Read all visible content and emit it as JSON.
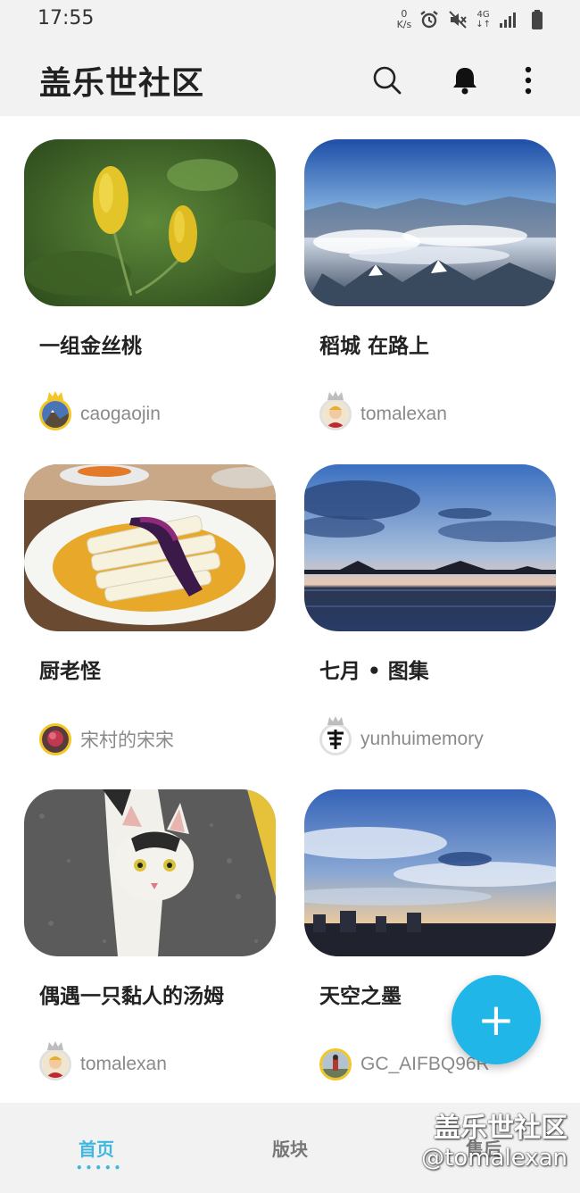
{
  "status_bar": {
    "time": "17:55",
    "net_speed_value": "0",
    "net_speed_unit": "K/s",
    "network_type": "4G",
    "icons": [
      "alarm-icon",
      "mute-icon",
      "signal-icon",
      "battery-icon"
    ]
  },
  "app_bar": {
    "title": "盖乐世社区",
    "actions": [
      "search-icon",
      "bell-icon",
      "more-vert-icon"
    ]
  },
  "cards": [
    {
      "title": "一组金丝桃",
      "author": "caogaojin"
    },
    {
      "title": "稻城 在路上",
      "author": "tomalexan"
    },
    {
      "title": "厨老怪",
      "author": "宋村的宋宋"
    },
    {
      "title": "七月 • 图集",
      "author": "yunhuimemory"
    },
    {
      "title": "偶遇一只黏人的汤姆",
      "author": "tomalexan"
    },
    {
      "title": "天空之墨",
      "author": "GC_AIFBQ96R"
    }
  ],
  "fab": {
    "icon": "plus-icon",
    "label": "+"
  },
  "bottom_nav": {
    "items": [
      {
        "label": "首页"
      },
      {
        "label": "版块"
      },
      {
        "label": "售后"
      }
    ],
    "active_indicator": "•••••"
  },
  "watermark": {
    "line1": "盖乐世社区",
    "line2": "@tomalexan"
  },
  "colors": {
    "accent": "#21b6e8",
    "nav_active": "#3fb8e0",
    "bar_bg": "#f2f2f2"
  }
}
